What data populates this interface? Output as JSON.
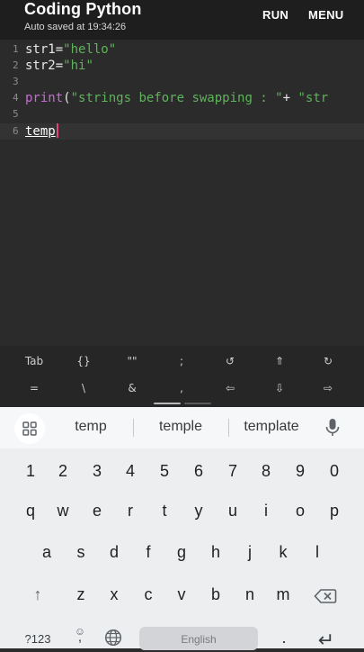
{
  "header": {
    "title": "Coding Python",
    "subtitle": "Auto saved at 19:34:26",
    "run_label": "RUN",
    "menu_label": "MENU"
  },
  "editor": {
    "line_numbers": [
      "1",
      "2",
      "3",
      "4",
      "5",
      "6"
    ],
    "line1": {
      "ident": "str1=",
      "str": "\"hello\""
    },
    "line2": {
      "ident": "str2=",
      "str": "\"hi\""
    },
    "line4": {
      "fn": "print",
      "paren": "(",
      "str": "\"strings before swapping : \"",
      "plus": "+ ",
      "str2": "\"str"
    },
    "line6": {
      "word": "temp"
    }
  },
  "symbols_row1": [
    "Tab",
    "{}",
    "\"\"",
    ";",
    "↺",
    "⇑",
    "↻"
  ],
  "symbols_row2": [
    "=",
    "\\",
    "&",
    ",",
    "⇦",
    "⇩",
    "⇨"
  ],
  "suggestions": [
    "temp",
    "temple",
    "template"
  ],
  "keyboard": {
    "row_numbers": [
      "1",
      "2",
      "3",
      "4",
      "5",
      "6",
      "7",
      "8",
      "9",
      "0"
    ],
    "row1": [
      "q",
      "w",
      "e",
      "r",
      "t",
      "y",
      "u",
      "i",
      "o",
      "p"
    ],
    "row2": [
      "a",
      "s",
      "d",
      "f",
      "g",
      "h",
      "j",
      "k",
      "l"
    ],
    "row3": [
      "z",
      "x",
      "c",
      "v",
      "b",
      "n",
      "m"
    ],
    "shift": "↑",
    "sym_label": "?123",
    "emoji": "☺",
    "comma": ",",
    "space_label": "English",
    "period": ".",
    "enter": "↵"
  },
  "colors": {
    "string": "#5fb35a",
    "function": "#c86ad6",
    "cursor": "#e0447b"
  }
}
